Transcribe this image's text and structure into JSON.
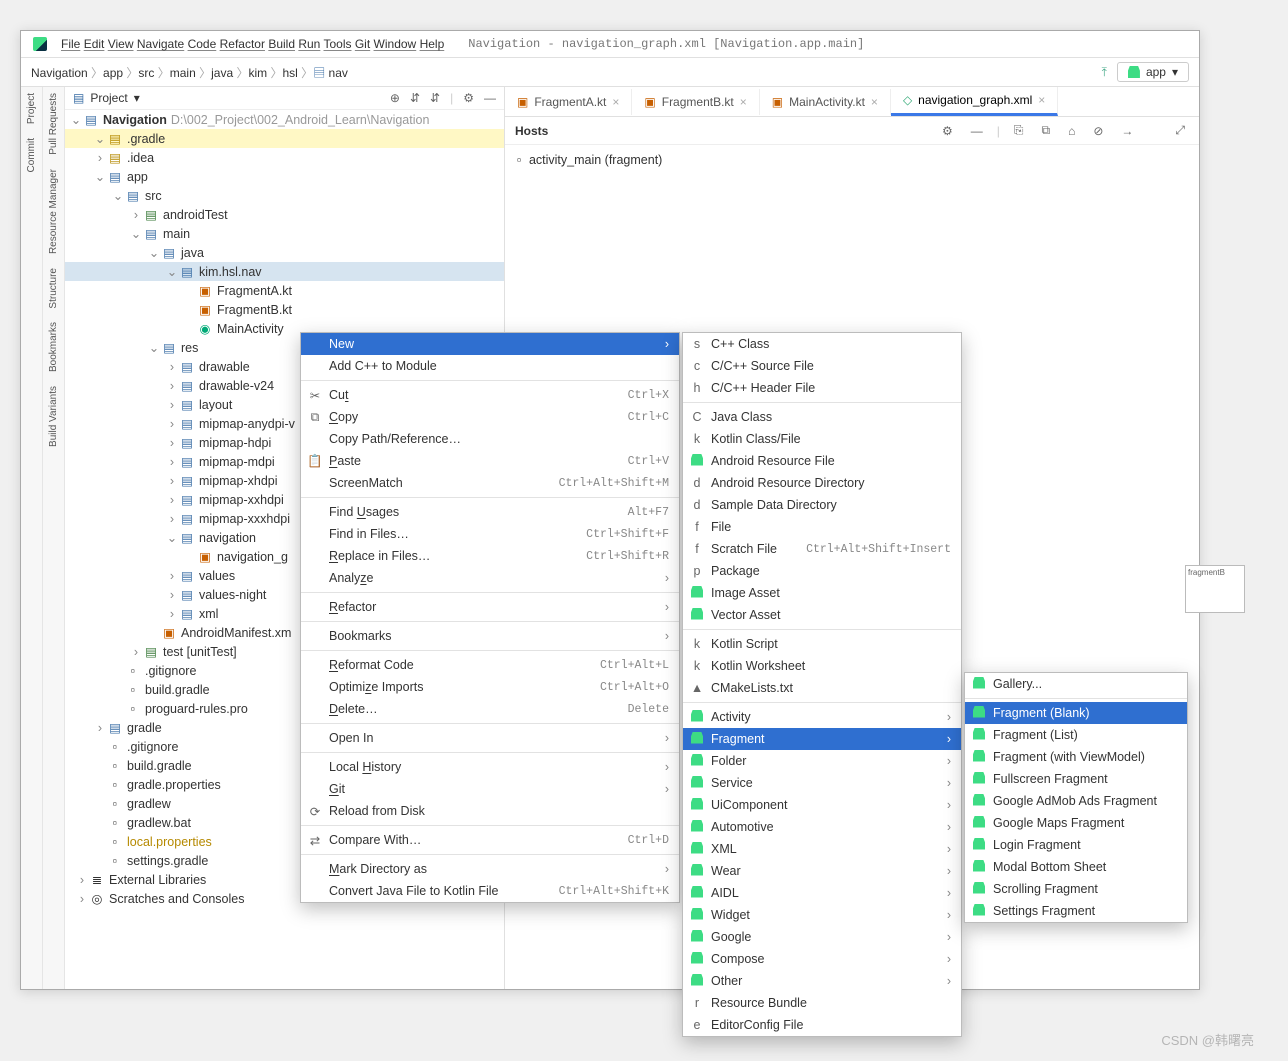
{
  "title": "Navigation - navigation_graph.xml [Navigation.app.main]",
  "menus": [
    "File",
    "Edit",
    "View",
    "Navigate",
    "Code",
    "Refactor",
    "Build",
    "Run",
    "Tools",
    "Git",
    "Window",
    "Help"
  ],
  "breadcrumbs": [
    "Navigation",
    "app",
    "src",
    "main",
    "java",
    "kim",
    "hsl",
    "nav"
  ],
  "run_config": "app",
  "project_label": "Project",
  "root_label": "Navigation",
  "root_path": "D:\\002_Project\\002_Android_Learn\\Navigation",
  "leftrail_top": [
    "Project",
    "Commit"
  ],
  "leftrail_bottom": [
    "Pull Requests",
    "Resource Manager",
    "Structure",
    "Bookmarks",
    "Build Variants"
  ],
  "tree": [
    {
      "d": 1,
      "a": "v",
      "i": "folder-y",
      "t": ".gradle",
      "hl": true
    },
    {
      "d": 1,
      "a": ">",
      "i": "folder-y",
      "t": ".idea"
    },
    {
      "d": 1,
      "a": "v",
      "i": "folder-b",
      "t": "app"
    },
    {
      "d": 2,
      "a": "v",
      "i": "folder-b",
      "t": "src"
    },
    {
      "d": 3,
      "a": ">",
      "i": "folder-g",
      "t": "androidTest"
    },
    {
      "d": 3,
      "a": "v",
      "i": "folder-b",
      "t": "main"
    },
    {
      "d": 4,
      "a": "v",
      "i": "folder-b",
      "t": "java"
    },
    {
      "d": 5,
      "a": "v",
      "i": "folder-b",
      "t": "kim.hsl.nav",
      "sel": true
    },
    {
      "d": 6,
      "a": " ",
      "i": "file-k",
      "t": "FragmentA.kt"
    },
    {
      "d": 6,
      "a": " ",
      "i": "file-k",
      "t": "FragmentB.kt"
    },
    {
      "d": 6,
      "a": " ",
      "i": "file-g",
      "t": "MainActivity"
    },
    {
      "d": 4,
      "a": "v",
      "i": "folder-b",
      "t": "res"
    },
    {
      "d": 5,
      "a": ">",
      "i": "folder-b",
      "t": "drawable"
    },
    {
      "d": 5,
      "a": ">",
      "i": "folder-b",
      "t": "drawable-v24"
    },
    {
      "d": 5,
      "a": ">",
      "i": "folder-b",
      "t": "layout"
    },
    {
      "d": 5,
      "a": ">",
      "i": "folder-b",
      "t": "mipmap-anydpi-v"
    },
    {
      "d": 5,
      "a": ">",
      "i": "folder-b",
      "t": "mipmap-hdpi"
    },
    {
      "d": 5,
      "a": ">",
      "i": "folder-b",
      "t": "mipmap-mdpi"
    },
    {
      "d": 5,
      "a": ">",
      "i": "folder-b",
      "t": "mipmap-xhdpi"
    },
    {
      "d": 5,
      "a": ">",
      "i": "folder-b",
      "t": "mipmap-xxhdpi"
    },
    {
      "d": 5,
      "a": ">",
      "i": "folder-b",
      "t": "mipmap-xxxhdpi"
    },
    {
      "d": 5,
      "a": "v",
      "i": "folder-b",
      "t": "navigation"
    },
    {
      "d": 6,
      "a": " ",
      "i": "file-k",
      "t": "navigation_g"
    },
    {
      "d": 5,
      "a": ">",
      "i": "folder-b",
      "t": "values"
    },
    {
      "d": 5,
      "a": ">",
      "i": "folder-b",
      "t": "values-night"
    },
    {
      "d": 5,
      "a": ">",
      "i": "folder-b",
      "t": "xml"
    },
    {
      "d": 4,
      "a": " ",
      "i": "file-k",
      "t": "AndroidManifest.xm"
    },
    {
      "d": 3,
      "a": ">",
      "i": "folder-g",
      "t": "test [unitTest]"
    },
    {
      "d": 2,
      "a": " ",
      "i": "file",
      "t": ".gitignore"
    },
    {
      "d": 2,
      "a": " ",
      "i": "file",
      "t": "build.gradle"
    },
    {
      "d": 2,
      "a": " ",
      "i": "file",
      "t": "proguard-rules.pro"
    },
    {
      "d": 1,
      "a": ">",
      "i": "folder-b",
      "t": "gradle"
    },
    {
      "d": 1,
      "a": " ",
      "i": "file",
      "t": ".gitignore"
    },
    {
      "d": 1,
      "a": " ",
      "i": "file",
      "t": "build.gradle"
    },
    {
      "d": 1,
      "a": " ",
      "i": "file",
      "t": "gradle.properties"
    },
    {
      "d": 1,
      "a": " ",
      "i": "file",
      "t": "gradlew"
    },
    {
      "d": 1,
      "a": " ",
      "i": "file",
      "t": "gradlew.bat"
    },
    {
      "d": 1,
      "a": " ",
      "i": "file",
      "t": "local.properties",
      "style": "color:#b58900"
    },
    {
      "d": 1,
      "a": " ",
      "i": "file",
      "t": "settings.gradle"
    },
    {
      "d": 0,
      "a": ">",
      "i": "lib",
      "t": "External Libraries"
    },
    {
      "d": 0,
      "a": ">",
      "i": "scratch",
      "t": "Scratches and Consoles"
    }
  ],
  "tabs": [
    {
      "label": "FragmentA.kt"
    },
    {
      "label": "FragmentB.kt"
    },
    {
      "label": "MainActivity.kt"
    },
    {
      "label": "navigation_graph.xml",
      "active": true
    }
  ],
  "hosts_label": "Hosts",
  "editor_line": "activity_main (fragment)",
  "preview_label": "fragmentB",
  "ctx1": [
    {
      "t": "New",
      "sel": true,
      "sub": true
    },
    {
      "t": "Add C++ to Module"
    },
    {
      "sep": true
    },
    {
      "t": "Cut",
      "ic": "✂",
      "sc": "Ctrl+X",
      "u": "t"
    },
    {
      "t": "Copy",
      "ic": "⧉",
      "sc": "Ctrl+C",
      "u": "C"
    },
    {
      "t": "Copy Path/Reference…"
    },
    {
      "t": "Paste",
      "ic": "📋",
      "sc": "Ctrl+V",
      "u": "P"
    },
    {
      "t": "ScreenMatch",
      "sc": "Ctrl+Alt+Shift+M"
    },
    {
      "sep": true
    },
    {
      "t": "Find Usages",
      "sc": "Alt+F7",
      "u": "U"
    },
    {
      "t": "Find in Files…",
      "sc": "Ctrl+Shift+F"
    },
    {
      "t": "Replace in Files…",
      "sc": "Ctrl+Shift+R",
      "u": "R"
    },
    {
      "t": "Analyze",
      "sub": true,
      "u": "z"
    },
    {
      "sep": true
    },
    {
      "t": "Refactor",
      "sub": true,
      "u": "R"
    },
    {
      "sep": true
    },
    {
      "t": "Bookmarks",
      "sub": true
    },
    {
      "sep": true
    },
    {
      "t": "Reformat Code",
      "sc": "Ctrl+Alt+L",
      "u": "R"
    },
    {
      "t": "Optimize Imports",
      "sc": "Ctrl+Alt+O",
      "u": "z"
    },
    {
      "t": "Delete…",
      "sc": "Delete",
      "u": "D"
    },
    {
      "sep": true
    },
    {
      "t": "Open In",
      "sub": true
    },
    {
      "sep": true
    },
    {
      "t": "Local History",
      "sub": true,
      "u": "H"
    },
    {
      "t": "Git",
      "sub": true,
      "u": "G"
    },
    {
      "t": "Reload from Disk",
      "ic": "⟳"
    },
    {
      "sep": true
    },
    {
      "t": "Compare With…",
      "ic": "⇄",
      "sc": "Ctrl+D"
    },
    {
      "sep": true
    },
    {
      "t": "Mark Directory as",
      "sub": true,
      "u": "M"
    },
    {
      "t": "Convert Java File to Kotlin File",
      "sc": "Ctrl+Alt+Shift+K"
    }
  ],
  "ctx2": [
    {
      "t": "C++ Class",
      "ic": "s"
    },
    {
      "t": "C/C++ Source File",
      "ic": "c"
    },
    {
      "t": "C/C++ Header File",
      "ic": "h"
    },
    {
      "sep": true
    },
    {
      "t": "Java Class",
      "ic": "C"
    },
    {
      "t": "Kotlin Class/File",
      "ic": "k"
    },
    {
      "t": "Android Resource File",
      "ic": "a"
    },
    {
      "t": "Android Resource Directory",
      "ic": "d"
    },
    {
      "t": "Sample Data Directory",
      "ic": "d"
    },
    {
      "t": "File",
      "ic": "f"
    },
    {
      "t": "Scratch File",
      "ic": "f",
      "sc": "Ctrl+Alt+Shift+Insert"
    },
    {
      "t": "Package",
      "ic": "p"
    },
    {
      "t": "Image Asset",
      "ic": "a"
    },
    {
      "t": "Vector Asset",
      "ic": "a"
    },
    {
      "sep": true
    },
    {
      "t": "Kotlin Script",
      "ic": "k"
    },
    {
      "t": "Kotlin Worksheet",
      "ic": "k"
    },
    {
      "t": "CMakeLists.txt",
      "ic": "▲"
    },
    {
      "sep": true
    },
    {
      "t": "Activity",
      "ic": "a",
      "sub": true
    },
    {
      "t": "Fragment",
      "ic": "a",
      "sub": true,
      "sel": true
    },
    {
      "t": "Folder",
      "ic": "a",
      "sub": true
    },
    {
      "t": "Service",
      "ic": "a",
      "sub": true
    },
    {
      "t": "UiComponent",
      "ic": "a",
      "sub": true
    },
    {
      "t": "Automotive",
      "ic": "a",
      "sub": true
    },
    {
      "t": "XML",
      "ic": "a",
      "sub": true
    },
    {
      "t": "Wear",
      "ic": "a",
      "sub": true
    },
    {
      "t": "AIDL",
      "ic": "a",
      "sub": true
    },
    {
      "t": "Widget",
      "ic": "a",
      "sub": true
    },
    {
      "t": "Google",
      "ic": "a",
      "sub": true
    },
    {
      "t": "Compose",
      "ic": "a",
      "sub": true
    },
    {
      "t": "Other",
      "ic": "a",
      "sub": true
    },
    {
      "t": "Resource Bundle",
      "ic": "r"
    },
    {
      "t": "EditorConfig File",
      "ic": "e"
    }
  ],
  "ctx3": [
    {
      "t": "Gallery...",
      "ic": "a"
    },
    {
      "sep": true
    },
    {
      "t": "Fragment (Blank)",
      "ic": "a",
      "sel": true
    },
    {
      "t": "Fragment (List)",
      "ic": "a"
    },
    {
      "t": "Fragment (with ViewModel)",
      "ic": "a"
    },
    {
      "t": "Fullscreen Fragment",
      "ic": "a"
    },
    {
      "t": "Google AdMob Ads Fragment",
      "ic": "a"
    },
    {
      "t": "Google Maps Fragment",
      "ic": "a"
    },
    {
      "t": "Login Fragment",
      "ic": "a"
    },
    {
      "t": "Modal Bottom Sheet",
      "ic": "a"
    },
    {
      "t": "Scrolling Fragment",
      "ic": "a"
    },
    {
      "t": "Settings Fragment",
      "ic": "a"
    }
  ],
  "watermark": "CSDN @韩曙亮"
}
